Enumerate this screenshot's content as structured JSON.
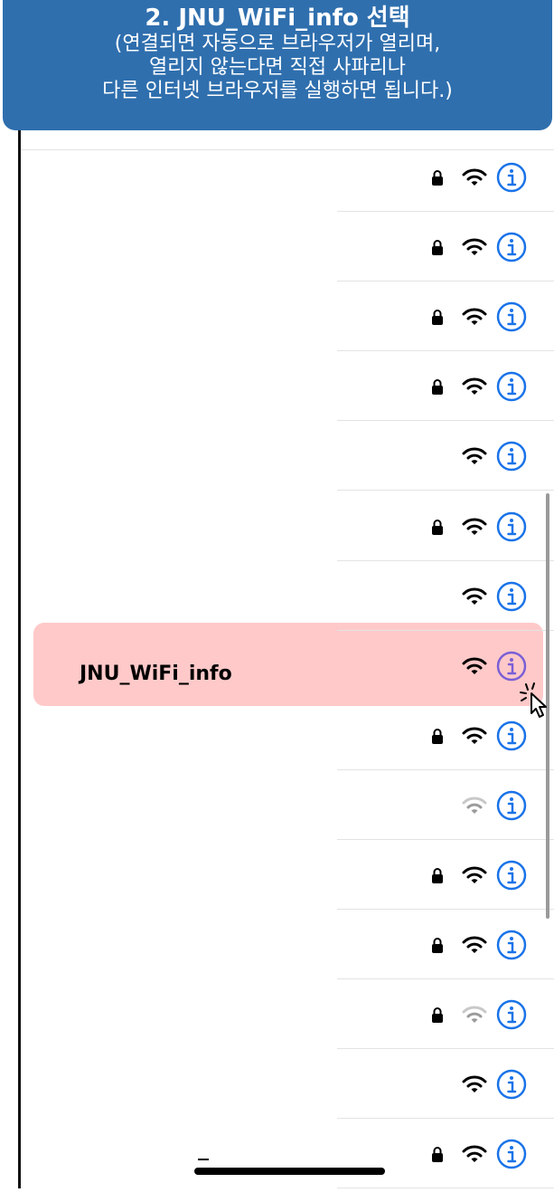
{
  "banner": {
    "title": "2. JNU_WiFi_info 선택",
    "line1": "(연결되면 자동으로 브라우저가 열리며,",
    "line2": "열리지 않는다면 직접 사파리나",
    "line3": "다른 인터넷 브라우저를 실행하면 됩니다.)",
    "color": "#2f6fae"
  },
  "networks": [
    {
      "name": "",
      "locked": true,
      "signal": "full"
    },
    {
      "name": "",
      "locked": true,
      "signal": "full"
    },
    {
      "name": "",
      "locked": true,
      "signal": "full"
    },
    {
      "name": "",
      "locked": true,
      "signal": "full"
    },
    {
      "name": "",
      "locked": false,
      "signal": "full"
    },
    {
      "name": "",
      "locked": true,
      "signal": "full"
    },
    {
      "name": "",
      "locked": false,
      "signal": "full"
    },
    {
      "name": "JNU_WiFi_info",
      "locked": false,
      "signal": "full",
      "highlighted": true
    },
    {
      "name": "",
      "locked": true,
      "signal": "full"
    },
    {
      "name": "",
      "locked": false,
      "signal": "weak"
    },
    {
      "name": "",
      "locked": true,
      "signal": "full"
    },
    {
      "name": "",
      "locked": true,
      "signal": "full"
    },
    {
      "name": "",
      "locked": true,
      "signal": "weak"
    },
    {
      "name": "",
      "locked": false,
      "signal": "full"
    },
    {
      "name": "",
      "locked": true,
      "signal": "full"
    }
  ],
  "colors": {
    "accent": "#1a73e8",
    "highlight": "#ffc9c9",
    "info_highlighted": "#7a5fd6"
  },
  "icons": {
    "lock": "lock-icon",
    "wifi": "wifi-icon",
    "info": "info-icon",
    "cursor": "pointer-cursor-icon"
  }
}
